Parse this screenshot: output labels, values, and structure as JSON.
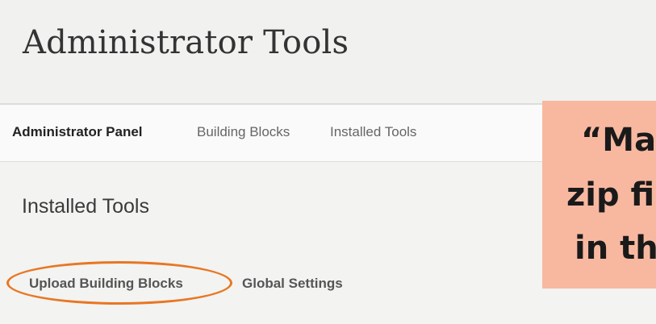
{
  "header": {
    "title": "Administrator Tools"
  },
  "tabs": [
    {
      "label": "Administrator Panel",
      "active": true
    },
    {
      "label": "Building Blocks",
      "active": false
    },
    {
      "label": "Installed Tools",
      "active": false
    }
  ],
  "section": {
    "title": "Installed Tools"
  },
  "subtabs": [
    {
      "label": "Upload Building Blocks",
      "highlighted": true
    },
    {
      "label": "Global Settings",
      "highlighted": false
    }
  ],
  "callout": {
    "lines": [
      "“Ma",
      "zip fi",
      "in th"
    ],
    "background": "#f8b8a0",
    "ring_color": "#e87722"
  }
}
